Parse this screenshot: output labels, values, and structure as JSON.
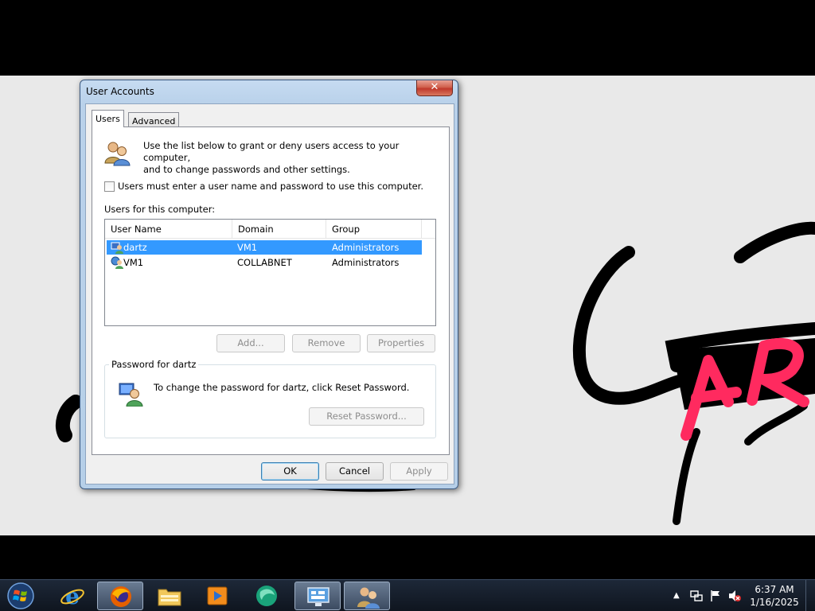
{
  "dialog": {
    "title": "User Accounts",
    "close_label": "✕"
  },
  "tabs": [
    {
      "label": "Users",
      "selected": true
    },
    {
      "label": "Advanced",
      "selected": false
    }
  ],
  "intro": {
    "line1": "Use the list below to grant or deny users access to your computer,",
    "line2": "and to change passwords and other settings."
  },
  "must_enter": {
    "label": "Users must enter a user name and password to use this computer.",
    "checked": false
  },
  "users_label": "Users for this computer:",
  "table": {
    "columns": [
      "User Name",
      "Domain",
      "Group"
    ],
    "rows": [
      {
        "name": "dartz",
        "domain": "VM1",
        "group": "Administrators",
        "selected": true
      },
      {
        "name": "VM1",
        "domain": "COLLABNET",
        "group": "Administrators",
        "selected": false
      }
    ]
  },
  "list_buttons": {
    "add": "Add...",
    "remove": "Remove",
    "properties": "Properties"
  },
  "password": {
    "legend": "Password for dartz",
    "text": "To change the password for dartz, click Reset Password.",
    "reset_button": "Reset Password..."
  },
  "footer_buttons": {
    "ok": "OK",
    "cancel": "Cancel",
    "apply": "Apply"
  },
  "drawing": {
    "text": "AR",
    "colors": {
      "ink": "#000000",
      "highlight": "#ff2a5f"
    }
  },
  "taskbar": {
    "items": [
      {
        "name": "internet-explorer-icon"
      },
      {
        "name": "firefox-icon"
      },
      {
        "name": "file-explorer-icon"
      },
      {
        "name": "media-player-icon"
      },
      {
        "name": "browser-globe-icon"
      },
      {
        "name": "control-panel-icon"
      },
      {
        "name": "user-accounts-icon"
      }
    ],
    "clock": {
      "time": "6:37 AM",
      "date": "1/16/2025"
    }
  },
  "colors": {
    "selection": "#3399ff",
    "dialog_frame": "#b9d1ea",
    "desktop": "#e9e9e9"
  }
}
